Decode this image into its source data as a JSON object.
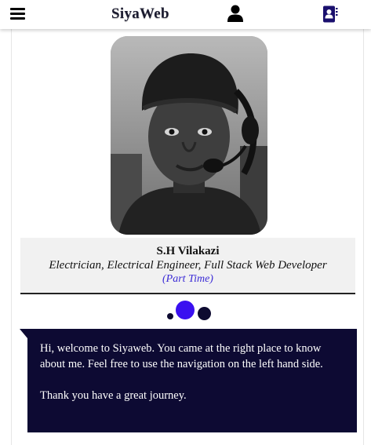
{
  "header": {
    "brand": "SiyaWeb",
    "menu_icon": "hamburger-menu-icon",
    "user_icon": "user-icon",
    "contact_icon": "contact-book-icon"
  },
  "profile": {
    "photo_alt": "S.H Vilakazi",
    "name": "S.H Vilakazi",
    "roles": "Electrician, Electrical Engineer, Full Stack Web Developer",
    "note": "(Part Time)"
  },
  "carousel": {
    "active_index": 1,
    "count": 3
  },
  "welcome": {
    "paragraph_1": "Hi, welcome to Siyaweb. You came at the right place to know about me. Feel free to use the navigation on the left hand side.",
    "paragraph_2": "Thank you have a great journey."
  },
  "colors": {
    "panel": "#0d0a33",
    "accent": "#3a10f0",
    "note": "#3b2bd6"
  }
}
